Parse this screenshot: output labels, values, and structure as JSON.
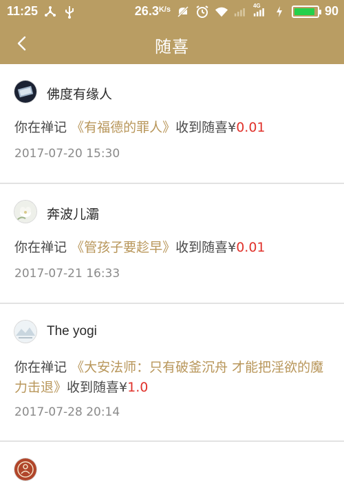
{
  "status_bar": {
    "time": "11:25",
    "speed_value": "26.3",
    "speed_unit": "K/s",
    "network_type": "4G",
    "battery_percent": "90",
    "battery_level": 0.9,
    "icons": [
      "usb-icon",
      "tether-icon",
      "mute-icon",
      "alarm-icon",
      "wifi-icon",
      "signal-icon",
      "charging-icon",
      "battery-icon"
    ]
  },
  "header": {
    "title": "随喜",
    "back_icon": "chevron-left-icon"
  },
  "colors": {
    "header_bg": "#b99d63",
    "article_title": "#b8965a",
    "amount": "#e0322b",
    "timestamp": "#8a8a8a"
  },
  "feed": [
    {
      "user": "佛度有缘人",
      "prefix": "你在禅记",
      "article": "《有福德的罪人》",
      "suffix": "收到随喜",
      "currency": "¥",
      "amount": "0.01",
      "time": "2017-07-20 15:30"
    },
    {
      "user": "奔波儿灞",
      "prefix": "你在禅记",
      "article": "《管孩子要趁早》",
      "suffix": "收到随喜",
      "currency": "¥",
      "amount": "0.01",
      "time": "2017-07-21 16:33"
    },
    {
      "user": "The yogi",
      "prefix": "你在禅记",
      "article": "《大安法师：只有破釜沉舟 才能把淫欲的魔力击退》",
      "suffix": "收到随喜",
      "currency": "¥",
      "amount": "1.0",
      "time": "2017-07-28 20:14"
    }
  ]
}
